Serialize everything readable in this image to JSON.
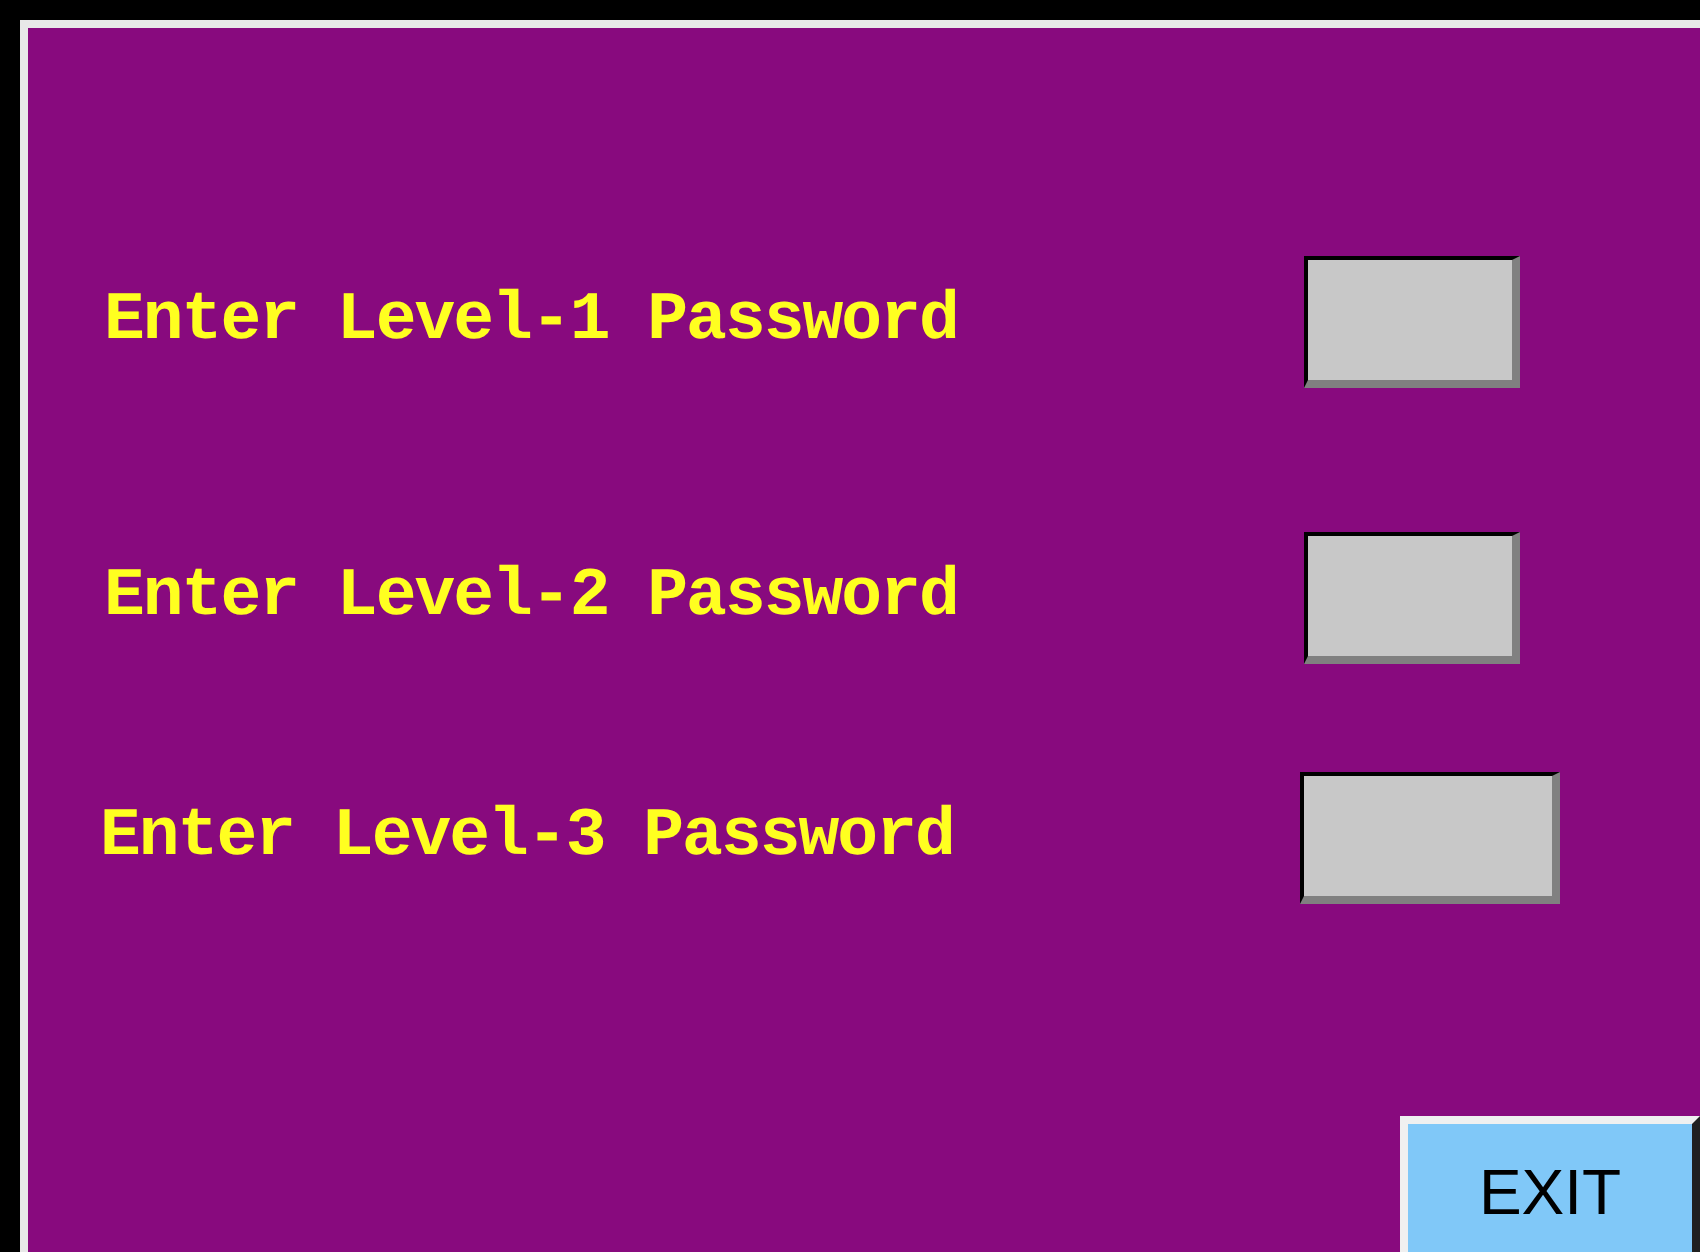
{
  "password_rows": [
    {
      "label": "Enter Level-1 Password"
    },
    {
      "label": "Enter Level-2 Password"
    },
    {
      "label": "Enter Level-3 Password"
    }
  ],
  "exit_button": {
    "label": "EXIT"
  }
}
